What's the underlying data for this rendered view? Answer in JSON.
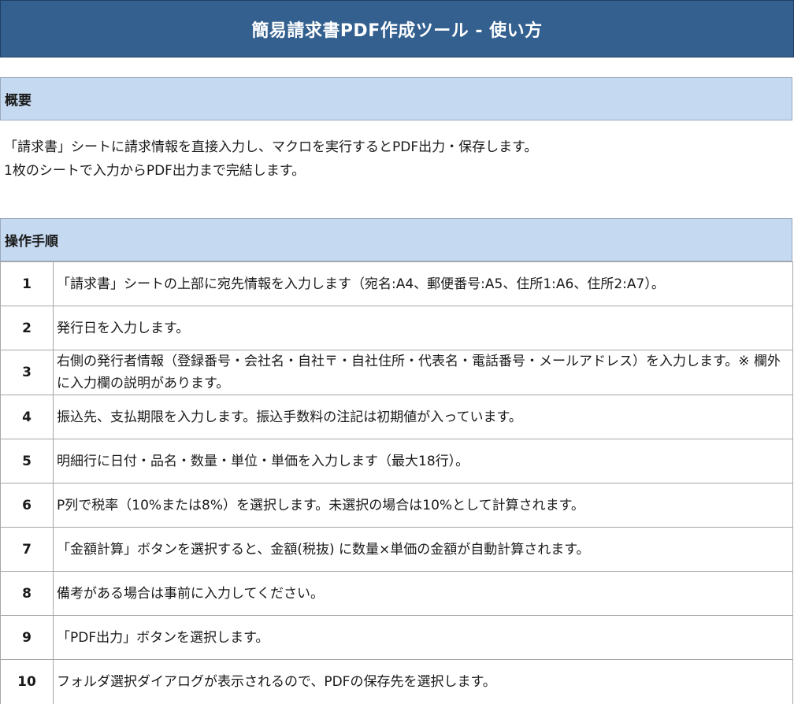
{
  "title": "簡易請求書PDF作成ツール - 使い方",
  "overview": {
    "header": "概要",
    "lines": [
      "「請求書」シートに請求情報を直接入力し、マクロを実行するとPDF出力・保存します。",
      "1枚のシートで入力からPDF出力まで完結します。"
    ]
  },
  "steps": {
    "header": "操作手順",
    "items": [
      {
        "num": "1",
        "text": "「請求書」シートの上部に宛先情報を入力します（宛名:A4、郵便番号:A5、住所1:A6、住所2:A7）。"
      },
      {
        "num": "2",
        "text": "発行日を入力します。"
      },
      {
        "num": "3",
        "text": "右側の発行者情報（登録番号・会社名・自社〒・自社住所・代表名・電話番号・メールアドレス）を入力します。※ 欄外に入力欄の説明があります。"
      },
      {
        "num": "4",
        "text": "振込先、支払期限を入力します。振込手数料の注記は初期値が入っています。"
      },
      {
        "num": "5",
        "text": "明細行に日付・品名・数量・単位・単価を入力します（最大18行）。"
      },
      {
        "num": "6",
        "text": "P列で税率（10%または8%）を選択します。未選択の場合は10%として計算されます。"
      },
      {
        "num": "7",
        "text": "「金額計算」ボタンを選択すると、金額(税抜) に数量×単価の金額が自動計算されます。"
      },
      {
        "num": "8",
        "text": "備考がある場合は事前に入力してください。"
      },
      {
        "num": "9",
        "text": "「PDF出力」ボタンを選択します。"
      },
      {
        "num": "10",
        "text": "フォルダ選択ダイアログが表示されるので、PDFの保存先を選択します。"
      }
    ]
  }
}
